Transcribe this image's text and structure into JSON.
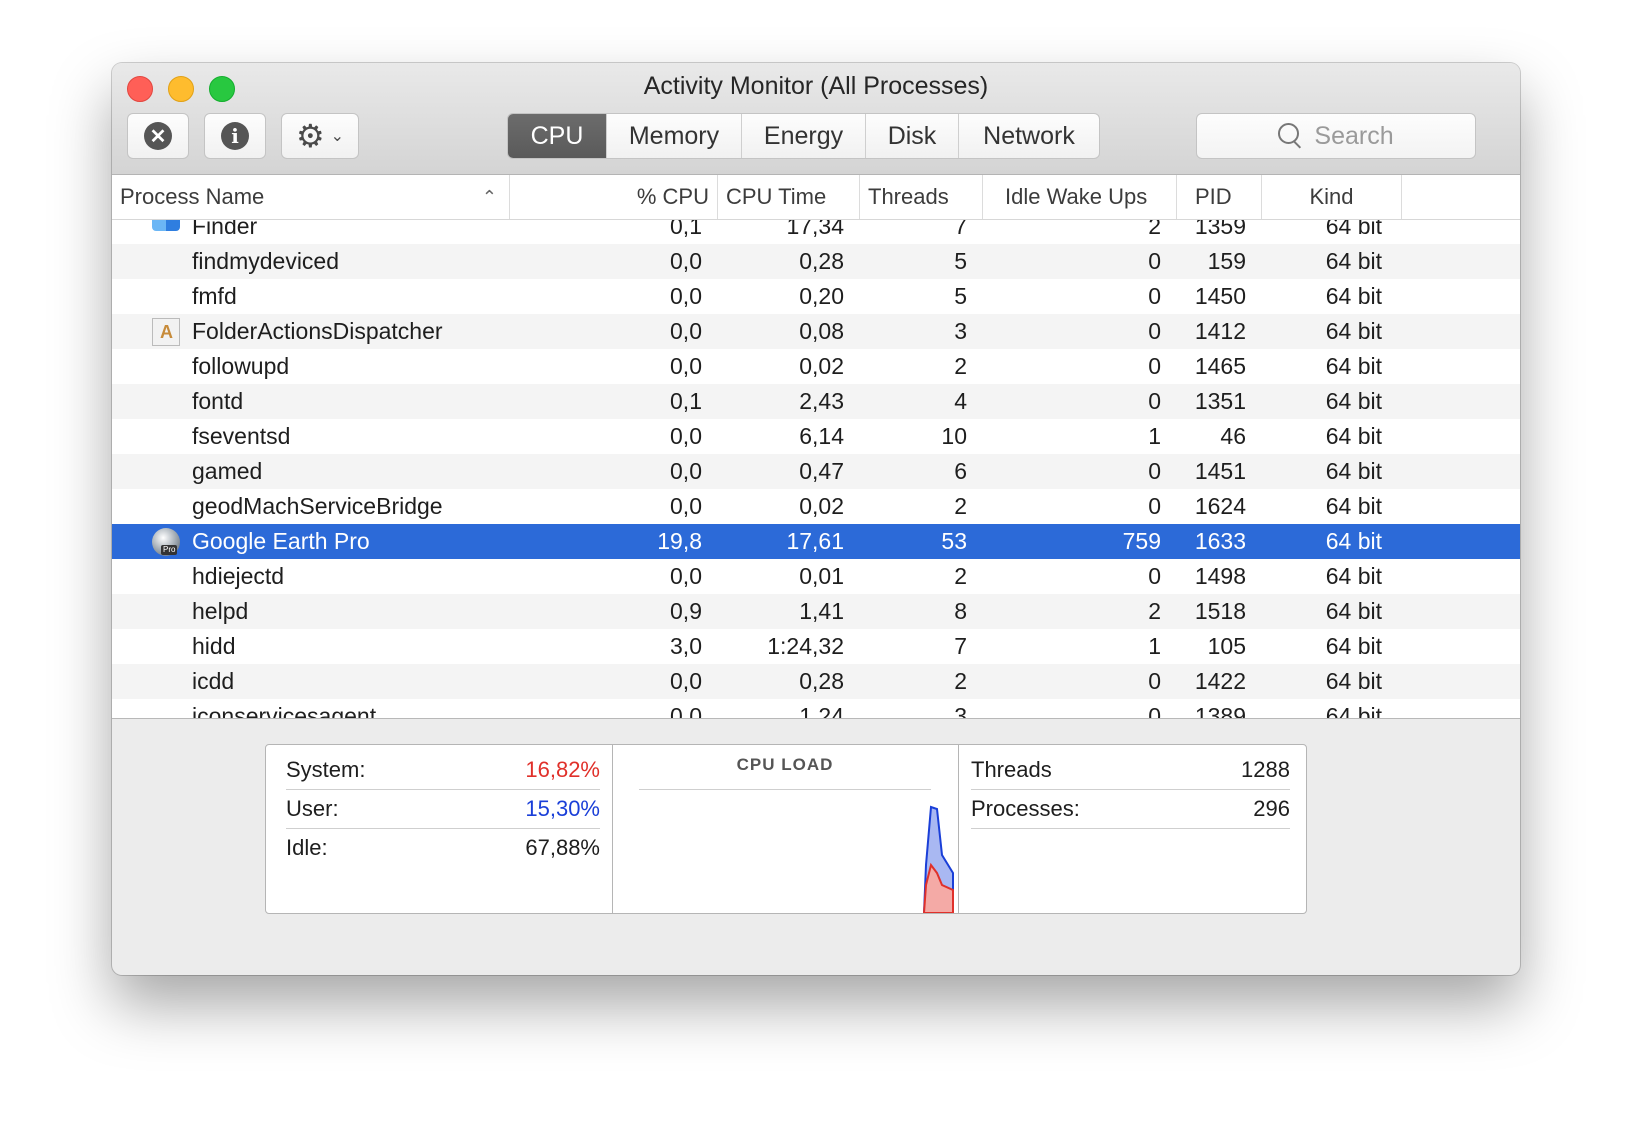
{
  "window": {
    "title": "Activity Monitor (All Processes)"
  },
  "toolbar": {
    "stop_glyph": "✕",
    "info_glyph": "i",
    "gear_glyph": "⚙",
    "chevron_glyph": "⌄",
    "tabs": [
      {
        "label": "CPU",
        "active": true
      },
      {
        "label": "Memory",
        "active": false
      },
      {
        "label": "Energy",
        "active": false
      },
      {
        "label": "Disk",
        "active": false
      },
      {
        "label": "Network",
        "active": false
      }
    ],
    "search_placeholder": "Search"
  },
  "table": {
    "columns": [
      "Process Name",
      "% CPU",
      "CPU Time",
      "Threads",
      "Idle Wake Ups",
      "PID",
      "Kind"
    ],
    "sort_indicator": "⌃",
    "rows": [
      {
        "name": "Finder",
        "cpu": "0,1",
        "cpu_time": "17,34",
        "threads": "7",
        "idle_wake_ups": "2",
        "pid": "1359",
        "kind": "64 bit",
        "icon": "finder-icon",
        "partial": true
      },
      {
        "name": "findmydeviced",
        "cpu": "0,0",
        "cpu_time": "0,28",
        "threads": "5",
        "idle_wake_ups": "0",
        "pid": "159",
        "kind": "64 bit"
      },
      {
        "name": "fmfd",
        "cpu": "0,0",
        "cpu_time": "0,20",
        "threads": "5",
        "idle_wake_ups": "0",
        "pid": "1450",
        "kind": "64 bit"
      },
      {
        "name": "FolderActionsDispatcher",
        "cpu": "0,0",
        "cpu_time": "0,08",
        "threads": "3",
        "idle_wake_ups": "0",
        "pid": "1412",
        "kind": "64 bit",
        "icon": "folder-actions-icon"
      },
      {
        "name": "followupd",
        "cpu": "0,0",
        "cpu_time": "0,02",
        "threads": "2",
        "idle_wake_ups": "0",
        "pid": "1465",
        "kind": "64 bit"
      },
      {
        "name": "fontd",
        "cpu": "0,1",
        "cpu_time": "2,43",
        "threads": "4",
        "idle_wake_ups": "0",
        "pid": "1351",
        "kind": "64 bit"
      },
      {
        "name": "fseventsd",
        "cpu": "0,0",
        "cpu_time": "6,14",
        "threads": "10",
        "idle_wake_ups": "1",
        "pid": "46",
        "kind": "64 bit"
      },
      {
        "name": "gamed",
        "cpu": "0,0",
        "cpu_time": "0,47",
        "threads": "6",
        "idle_wake_ups": "0",
        "pid": "1451",
        "kind": "64 bit"
      },
      {
        "name": "geodMachServiceBridge",
        "cpu": "0,0",
        "cpu_time": "0,02",
        "threads": "2",
        "idle_wake_ups": "0",
        "pid": "1624",
        "kind": "64 bit"
      },
      {
        "name": "Google Earth Pro",
        "cpu": "19,8",
        "cpu_time": "17,61",
        "threads": "53",
        "idle_wake_ups": "759",
        "pid": "1633",
        "kind": "64 bit",
        "icon": "google-earth-pro-icon",
        "icon_badge": "Pro",
        "selected": true
      },
      {
        "name": "hdiejectd",
        "cpu": "0,0",
        "cpu_time": "0,01",
        "threads": "2",
        "idle_wake_ups": "0",
        "pid": "1498",
        "kind": "64 bit"
      },
      {
        "name": "helpd",
        "cpu": "0,9",
        "cpu_time": "1,41",
        "threads": "8",
        "idle_wake_ups": "2",
        "pid": "1518",
        "kind": "64 bit"
      },
      {
        "name": "hidd",
        "cpu": "3,0",
        "cpu_time": "1:24,32",
        "threads": "7",
        "idle_wake_ups": "1",
        "pid": "105",
        "kind": "64 bit"
      },
      {
        "name": "icdd",
        "cpu": "0,0",
        "cpu_time": "0,28",
        "threads": "2",
        "idle_wake_ups": "0",
        "pid": "1422",
        "kind": "64 bit"
      },
      {
        "name": "iconservicesagent",
        "cpu": "0,0",
        "cpu_time": "1,24",
        "threads": "3",
        "idle_wake_ups": "0",
        "pid": "1389",
        "kind": "64 bit"
      }
    ]
  },
  "summary": {
    "system_label": "System:",
    "system_value": "16,82%",
    "user_label": "User:",
    "user_value": "15,30%",
    "idle_label": "Idle:",
    "idle_value": "67,88%",
    "cpu_load_title": "CPU LOAD",
    "threads_label": "Threads",
    "threads_value": "1288",
    "processes_label": "Processes:",
    "processes_value": "296",
    "colors": {
      "system": "#e0302a",
      "user": "#1a3fd8"
    }
  }
}
